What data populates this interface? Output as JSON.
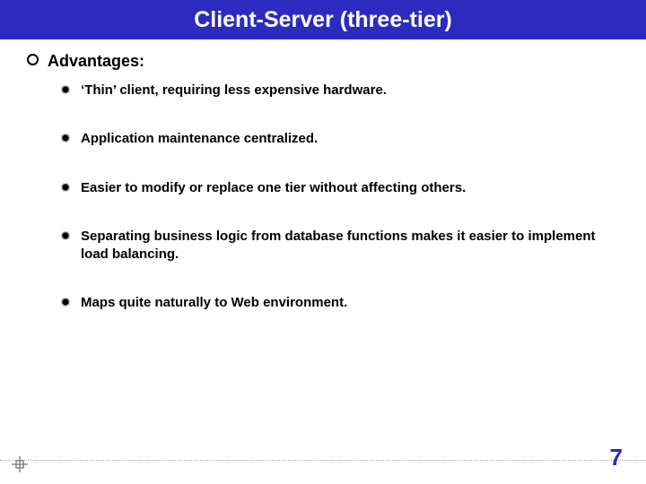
{
  "title": "Client-Server (three-tier)",
  "heading": "Advantages:",
  "bullets": [
    "‘Thin’ client, requiring less expensive hardware.",
    "Application maintenance centralized.",
    "Easier to modify or replace one tier without affecting others.",
    "Separating business logic from database functions makes it easier to implement load balancing.",
    "Maps quite naturally to Web environment."
  ],
  "page_number": "7"
}
